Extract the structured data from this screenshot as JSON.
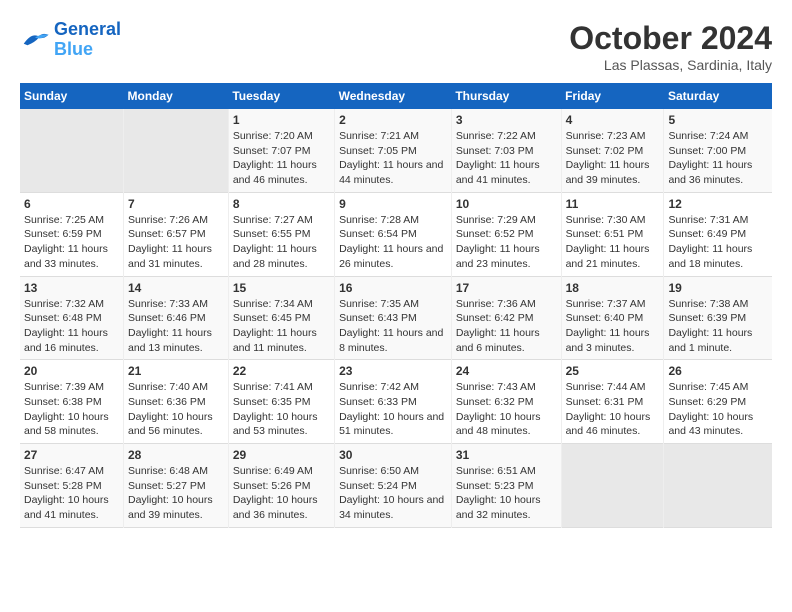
{
  "header": {
    "logo_line1": "General",
    "logo_line2": "Blue",
    "month_title": "October 2024",
    "location": "Las Plassas, Sardinia, Italy"
  },
  "days_of_week": [
    "Sunday",
    "Monday",
    "Tuesday",
    "Wednesday",
    "Thursday",
    "Friday",
    "Saturday"
  ],
  "weeks": [
    [
      {
        "day": "",
        "info": ""
      },
      {
        "day": "",
        "info": ""
      },
      {
        "day": "1",
        "info": "Sunrise: 7:20 AM\nSunset: 7:07 PM\nDaylight: 11 hours and 46 minutes."
      },
      {
        "day": "2",
        "info": "Sunrise: 7:21 AM\nSunset: 7:05 PM\nDaylight: 11 hours and 44 minutes."
      },
      {
        "day": "3",
        "info": "Sunrise: 7:22 AM\nSunset: 7:03 PM\nDaylight: 11 hours and 41 minutes."
      },
      {
        "day": "4",
        "info": "Sunrise: 7:23 AM\nSunset: 7:02 PM\nDaylight: 11 hours and 39 minutes."
      },
      {
        "day": "5",
        "info": "Sunrise: 7:24 AM\nSunset: 7:00 PM\nDaylight: 11 hours and 36 minutes."
      }
    ],
    [
      {
        "day": "6",
        "info": "Sunrise: 7:25 AM\nSunset: 6:59 PM\nDaylight: 11 hours and 33 minutes."
      },
      {
        "day": "7",
        "info": "Sunrise: 7:26 AM\nSunset: 6:57 PM\nDaylight: 11 hours and 31 minutes."
      },
      {
        "day": "8",
        "info": "Sunrise: 7:27 AM\nSunset: 6:55 PM\nDaylight: 11 hours and 28 minutes."
      },
      {
        "day": "9",
        "info": "Sunrise: 7:28 AM\nSunset: 6:54 PM\nDaylight: 11 hours and 26 minutes."
      },
      {
        "day": "10",
        "info": "Sunrise: 7:29 AM\nSunset: 6:52 PM\nDaylight: 11 hours and 23 minutes."
      },
      {
        "day": "11",
        "info": "Sunrise: 7:30 AM\nSunset: 6:51 PM\nDaylight: 11 hours and 21 minutes."
      },
      {
        "day": "12",
        "info": "Sunrise: 7:31 AM\nSunset: 6:49 PM\nDaylight: 11 hours and 18 minutes."
      }
    ],
    [
      {
        "day": "13",
        "info": "Sunrise: 7:32 AM\nSunset: 6:48 PM\nDaylight: 11 hours and 16 minutes."
      },
      {
        "day": "14",
        "info": "Sunrise: 7:33 AM\nSunset: 6:46 PM\nDaylight: 11 hours and 13 minutes."
      },
      {
        "day": "15",
        "info": "Sunrise: 7:34 AM\nSunset: 6:45 PM\nDaylight: 11 hours and 11 minutes."
      },
      {
        "day": "16",
        "info": "Sunrise: 7:35 AM\nSunset: 6:43 PM\nDaylight: 11 hours and 8 minutes."
      },
      {
        "day": "17",
        "info": "Sunrise: 7:36 AM\nSunset: 6:42 PM\nDaylight: 11 hours and 6 minutes."
      },
      {
        "day": "18",
        "info": "Sunrise: 7:37 AM\nSunset: 6:40 PM\nDaylight: 11 hours and 3 minutes."
      },
      {
        "day": "19",
        "info": "Sunrise: 7:38 AM\nSunset: 6:39 PM\nDaylight: 11 hours and 1 minute."
      }
    ],
    [
      {
        "day": "20",
        "info": "Sunrise: 7:39 AM\nSunset: 6:38 PM\nDaylight: 10 hours and 58 minutes."
      },
      {
        "day": "21",
        "info": "Sunrise: 7:40 AM\nSunset: 6:36 PM\nDaylight: 10 hours and 56 minutes."
      },
      {
        "day": "22",
        "info": "Sunrise: 7:41 AM\nSunset: 6:35 PM\nDaylight: 10 hours and 53 minutes."
      },
      {
        "day": "23",
        "info": "Sunrise: 7:42 AM\nSunset: 6:33 PM\nDaylight: 10 hours and 51 minutes."
      },
      {
        "day": "24",
        "info": "Sunrise: 7:43 AM\nSunset: 6:32 PM\nDaylight: 10 hours and 48 minutes."
      },
      {
        "day": "25",
        "info": "Sunrise: 7:44 AM\nSunset: 6:31 PM\nDaylight: 10 hours and 46 minutes."
      },
      {
        "day": "26",
        "info": "Sunrise: 7:45 AM\nSunset: 6:29 PM\nDaylight: 10 hours and 43 minutes."
      }
    ],
    [
      {
        "day": "27",
        "info": "Sunrise: 6:47 AM\nSunset: 5:28 PM\nDaylight: 10 hours and 41 minutes."
      },
      {
        "day": "28",
        "info": "Sunrise: 6:48 AM\nSunset: 5:27 PM\nDaylight: 10 hours and 39 minutes."
      },
      {
        "day": "29",
        "info": "Sunrise: 6:49 AM\nSunset: 5:26 PM\nDaylight: 10 hours and 36 minutes."
      },
      {
        "day": "30",
        "info": "Sunrise: 6:50 AM\nSunset: 5:24 PM\nDaylight: 10 hours and 34 minutes."
      },
      {
        "day": "31",
        "info": "Sunrise: 6:51 AM\nSunset: 5:23 PM\nDaylight: 10 hours and 32 minutes."
      },
      {
        "day": "",
        "info": ""
      },
      {
        "day": "",
        "info": ""
      }
    ]
  ]
}
